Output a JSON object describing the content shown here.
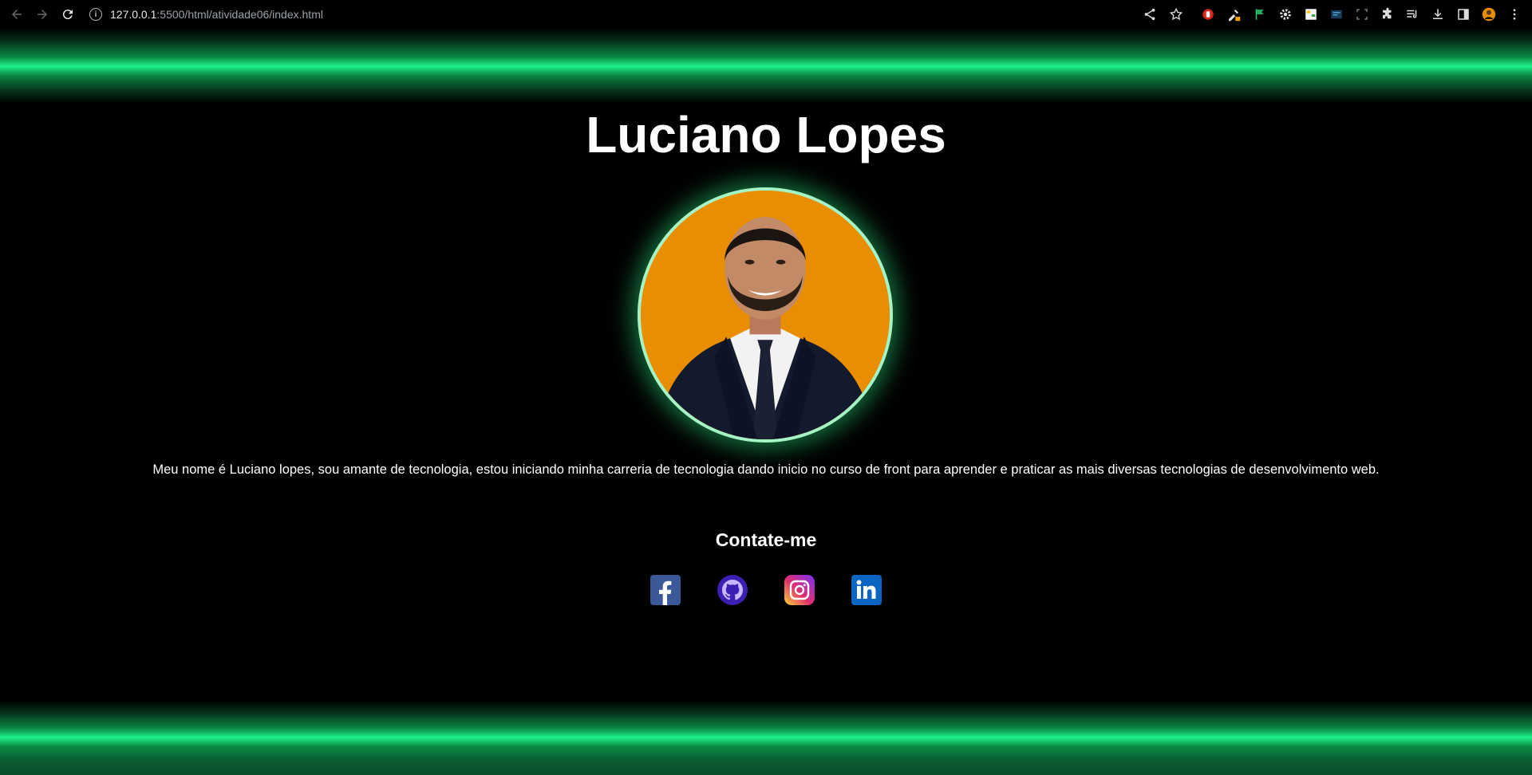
{
  "browser": {
    "url_host": "127.0.0.1",
    "url_path": ":5500/html/atividade06/index.html"
  },
  "page": {
    "title": "Luciano Lopes",
    "bio": "Meu nome é Luciano lopes, sou amante de tecnologia, estou iniciando minha carreria de tecnologia dando inicio no curso de front para aprender e praticar as mais diversas tecnologias de desenvolvimento web.",
    "contact_title": "Contate-me"
  },
  "social": [
    {
      "name": "facebook-icon",
      "color": "#3b5998"
    },
    {
      "name": "github-icon",
      "color": "#3d1fb3"
    },
    {
      "name": "instagram-icon",
      "color": "#e1306c"
    },
    {
      "name": "linkedin-icon",
      "color": "#0a66c2"
    }
  ],
  "colors": {
    "background": "#000000",
    "glow": "#21f08a",
    "avatar_bg": "#e88e00",
    "avatar_border": "#a6f3c6"
  }
}
